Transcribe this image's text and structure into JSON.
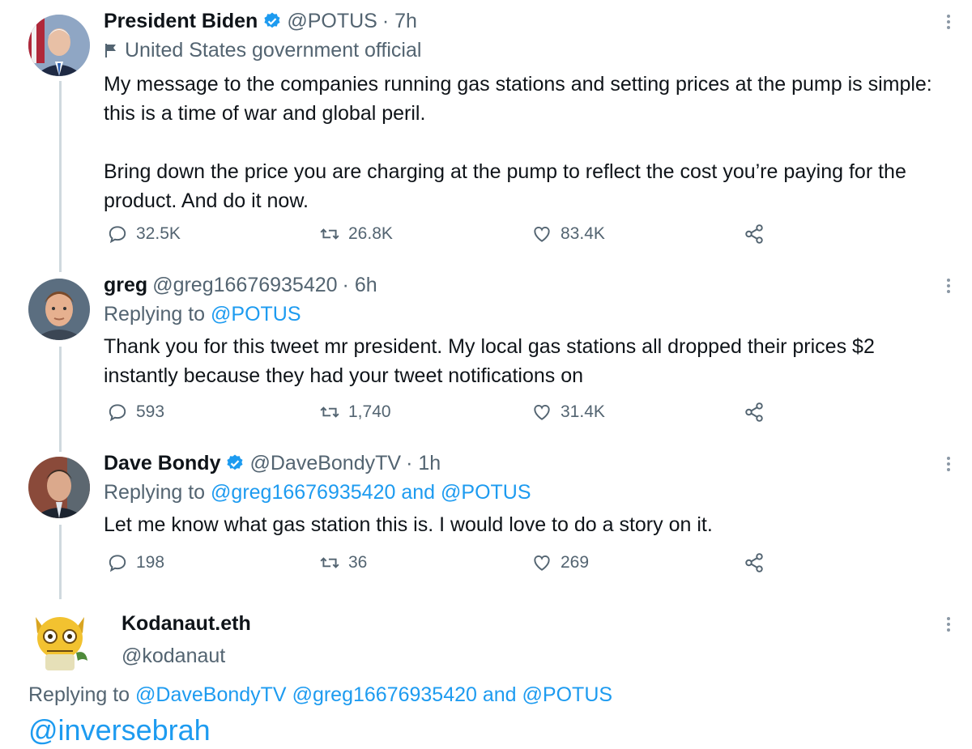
{
  "tweets": [
    {
      "name": "President Biden",
      "handle": "@POTUS",
      "time": "· 7h",
      "label": "United States government official",
      "text": [
        "My message to the companies running gas stations and setting prices at the pump is simple: this is a time of war and global peril.",
        "Bring down the price you are charging at the pump to reflect the cost you’re paying for the product. And do it now."
      ],
      "stats": {
        "replies": "32.5K",
        "retweets": "26.8K",
        "likes": "83.4K"
      }
    },
    {
      "name": "greg",
      "handle": "@greg16676935420",
      "time": "· 6h",
      "replying_prefix": "Replying to",
      "replying_to": "@POTUS",
      "text": "Thank you for this tweet mr president. My local gas stations all dropped their prices $2 instantly because they had your tweet notifications on",
      "stats": {
        "replies": "593",
        "retweets": "1,740",
        "likes": "31.4K"
      }
    },
    {
      "name": "Dave Bondy",
      "handle": "@DaveBondyTV",
      "time": "· 1h",
      "replying_prefix": "Replying to",
      "replying_to_1": "@greg16676935420",
      "replying_and": "and",
      "replying_to_2": "@POTUS",
      "text": "Let me know what gas station this is. I would love to do a story on it.",
      "stats": {
        "replies": "198",
        "retweets": "36",
        "likes": "269"
      }
    }
  ],
  "compose": {
    "name": "Kodanaut.eth",
    "handle": "@kodanaut",
    "replying_prefix": "Replying to",
    "replying_to_1": "@DaveBondyTV",
    "replying_to_2": "@greg16676935420",
    "replying_and": "and",
    "replying_to_3": "@POTUS",
    "draft": "@inversebrah"
  },
  "colors": {
    "accent": "#1d9bf0",
    "secondary": "#536471",
    "thread": "#cfd9de"
  },
  "icons": [
    "verified-badge-icon",
    "flag-icon",
    "reply-icon",
    "retweet-icon",
    "like-icon",
    "share-icon",
    "more-icon"
  ]
}
